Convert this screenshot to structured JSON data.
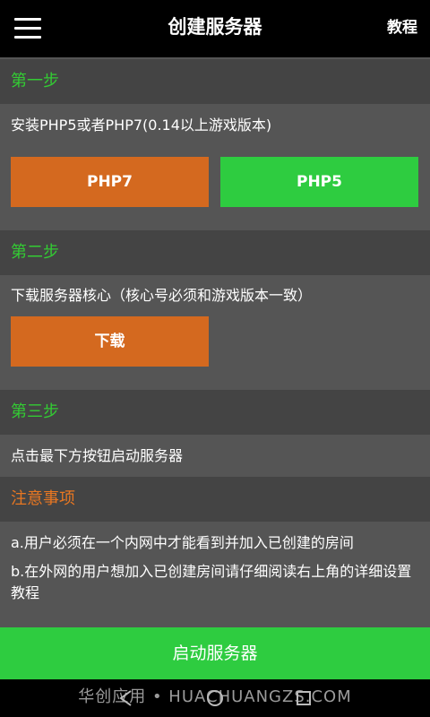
{
  "header": {
    "title": "创建服务器",
    "tutorial_label": "教程"
  },
  "step1": {
    "heading": "第一步",
    "description": "安装PHP5或者PHP7(0.14以上游戏版本)",
    "php7_label": "PHP7",
    "php5_label": "PHP5"
  },
  "step2": {
    "heading": "第二步",
    "description": "下载服务器核心（核心号必须和游戏版本一致）",
    "download_label": "下载"
  },
  "step3": {
    "heading": "第三步",
    "description": "点击最下方按钮启动服务器"
  },
  "notes": {
    "heading": "注意事项",
    "item_a": "a.用户必须在一个内网中才能看到并加入已创建的房间",
    "item_b": "b.在外网的用户想加入已创建房间请仔细阅读右上角的详细设置教程"
  },
  "start_button_label": "启动服务器",
  "watermark": "华创应用 • HUACHUANGZS.COM",
  "colors": {
    "step_heading": "#33cc33",
    "notes_heading": "#e87722",
    "orange_button": "#d4691f",
    "green_button": "#2ecc40"
  },
  "icons": [
    "menu-icon",
    "back-icon",
    "home-icon",
    "recent-apps-icon"
  ]
}
